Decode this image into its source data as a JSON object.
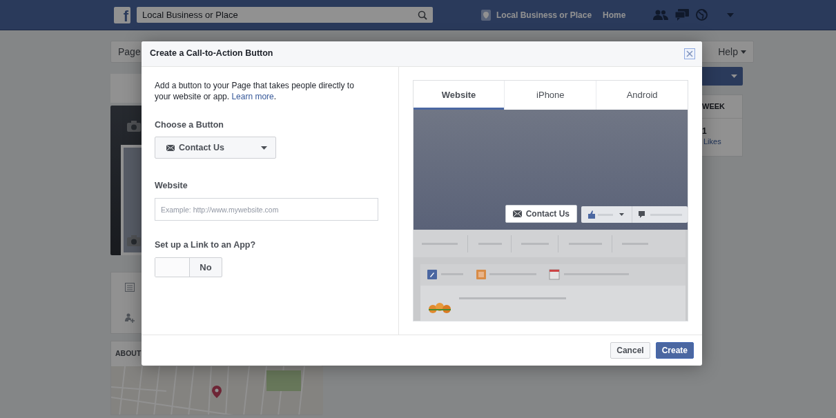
{
  "topbar": {
    "logo": "f",
    "search_value": "Local Business or Place",
    "profile_name": "Local Business or Place",
    "home_link": "Home"
  },
  "background": {
    "page_tab": "Page",
    "help_menu": "Help",
    "stats_title": "WEEK",
    "stats_count": "1",
    "stats_label": "Likes",
    "about_title": "ABOUT"
  },
  "dialog": {
    "title": "Create a Call-to-Action Button",
    "intro": "Add a button to your Page that takes people directly to your website or app.",
    "learn_more": "Learn more",
    "intro_end": ".",
    "choose_label": "Choose a Button",
    "button_choice": "Contact Us",
    "website_label": "Website",
    "website_placeholder": "Example: http://www.mywebsite.com",
    "app_link_label": "Set up a Link to an App?",
    "app_link": {
      "on": false,
      "label": "No"
    },
    "preview": {
      "tabs": [
        {
          "label": "Website",
          "selected": true
        },
        {
          "label": "iPhone",
          "selected": false
        },
        {
          "label": "Android",
          "selected": false
        }
      ],
      "cta_label": "Contact Us"
    },
    "buttons": [
      {
        "label": "Cancel",
        "kind": "secondary"
      },
      {
        "label": "Create",
        "kind": "primary"
      }
    ]
  }
}
